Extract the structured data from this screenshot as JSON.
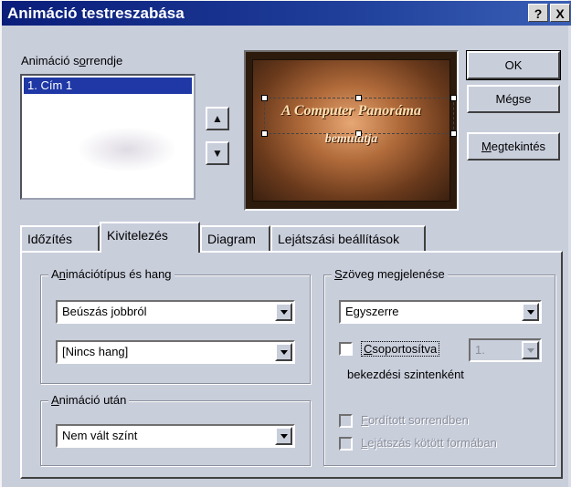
{
  "window": {
    "title": "Animáció testreszabása",
    "help_label": "?",
    "close_label": "X"
  },
  "order": {
    "label_pre": "Animáció s",
    "label_u": "o",
    "label_post": "rrendje",
    "items": [
      "1. Cím 1"
    ]
  },
  "move": {
    "up_icon": "arrow-up-icon",
    "down_icon": "arrow-down-icon"
  },
  "preview": {
    "line1": "A Computer Panoráma",
    "line2": "bemutatja"
  },
  "buttons": {
    "ok": "OK",
    "cancel": "Mégse",
    "preview_pre": "",
    "preview_u": "M",
    "preview_post": "egtekintés"
  },
  "tabs": [
    {
      "label": "Időzítés"
    },
    {
      "label": "Kivitelezés",
      "active": true
    },
    {
      "label": "Diagram"
    },
    {
      "label": "Lejátszási beállítások"
    }
  ],
  "effects": {
    "group_pre": "A",
    "group_u": "n",
    "group_post": "imációtípus és hang",
    "type_value": "Beúszás jobbról",
    "sound_value": "[Nincs hang]",
    "after_group_pre": "",
    "after_group_u": "A",
    "after_group_post": "nimáció után",
    "after_value": "Nem vált színt"
  },
  "text_appear": {
    "group_pre": "",
    "group_u": "S",
    "group_post": "zöveg megjelenése",
    "mode_value": "Egyszerre",
    "grouped_pre": "",
    "grouped_u": "C",
    "grouped_post": "soportosítva",
    "level_value": "1.",
    "grouped_sub": "bekezdési szintenként",
    "reverse_pre": "",
    "reverse_u": "F",
    "reverse_post": "ordított sorrendben",
    "attached_pre": "",
    "attached_u": "L",
    "attached_post": "ejátszás kötött formában"
  },
  "colors": {
    "title_bar": "#0a1d7a",
    "selection": "#1f38a6",
    "dialog_bg": "#c9cedb"
  }
}
